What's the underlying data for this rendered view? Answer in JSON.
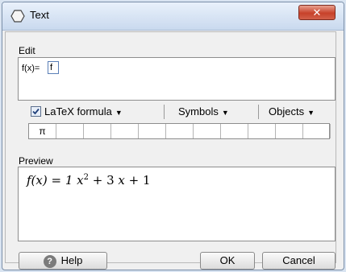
{
  "window": {
    "title": "Text",
    "icon": "text-tool-icon",
    "close_glyph": "✕"
  },
  "edit": {
    "section_label": "Edit",
    "prefix": "f(x)=",
    "field_value": "f"
  },
  "toolbar": {
    "latex_label": "LaTeX formula",
    "latex_checked": true,
    "symbols_label": "Symbols",
    "objects_label": "Objects",
    "caret": "▼"
  },
  "symbols": [
    "π",
    "",
    "",
    "",
    "",
    "",
    "",
    "",
    "",
    "",
    ""
  ],
  "preview": {
    "section_label": "Preview",
    "formula_lhs": "f(x) = 1 ",
    "formula_var1": "x",
    "formula_exp": "2",
    "formula_mid": " + 3 ",
    "formula_var2": "x",
    "formula_tail": " + 1"
  },
  "buttons": {
    "help": "Help",
    "ok": "OK",
    "cancel": "Cancel",
    "help_glyph": "?"
  }
}
